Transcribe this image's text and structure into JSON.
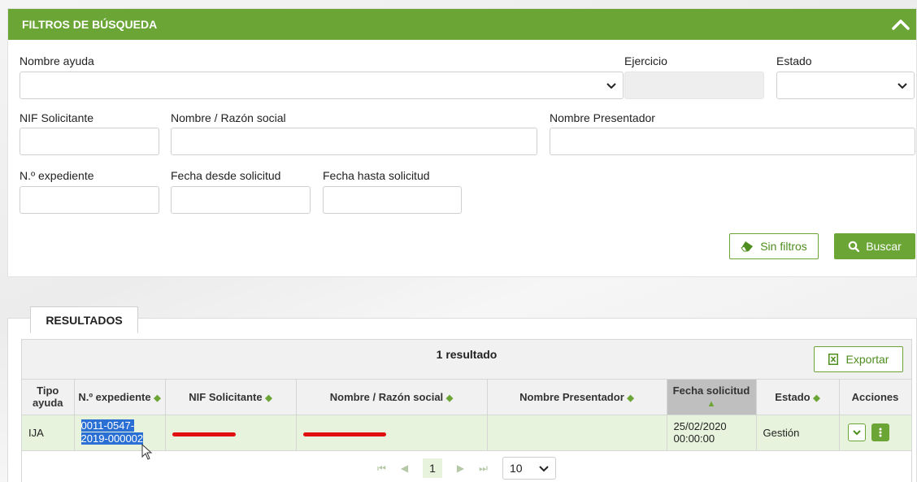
{
  "filters": {
    "title": "FILTROS DE BÚSQUEDA",
    "labels": {
      "nombre_ayuda": "Nombre ayuda",
      "ejercicio": "Ejercicio",
      "estado": "Estado",
      "nif": "NIF Solicitante",
      "razon_social": "Nombre / Razón social",
      "presentador": "Nombre Presentador",
      "expediente": "N.º expediente",
      "fecha_desde": "Fecha desde solicitud",
      "fecha_hasta": "Fecha hasta solicitud"
    },
    "buttons": {
      "sin_filtros": "Sin filtros",
      "buscar": "Buscar"
    }
  },
  "results": {
    "tab_label": "RESULTADOS",
    "summary": "1 resultado",
    "export_label": "Exportar",
    "columns": [
      "Tipo ayuda",
      "N.º expediente",
      "NIF Solicitante",
      "Nombre / Razón social",
      "Nombre Presentador",
      "Fecha solicitud",
      "Estado",
      "Acciones"
    ],
    "rows": [
      {
        "tipo": "IJA",
        "expediente_1": "0011-0547-",
        "expediente_2": "2019-000002",
        "presentador": "",
        "fecha_1": "25/02/2020",
        "fecha_2": "00:00:00",
        "estado": "Gestión"
      }
    ],
    "pagination": {
      "current_page": "1",
      "page_size": "10"
    }
  },
  "colors": {
    "brand_green": "#6aa535",
    "row_selected": "#e8f3dd",
    "redaction": "#e10f0f"
  }
}
